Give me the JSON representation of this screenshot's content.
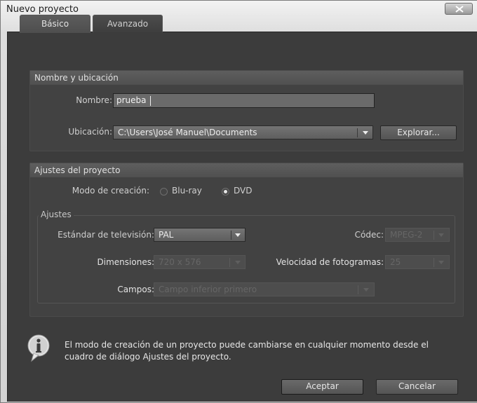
{
  "window": {
    "title": "Nuevo proyecto"
  },
  "tabs": [
    {
      "label": "Básico"
    },
    {
      "label": "Avanzado"
    }
  ],
  "name_location": {
    "header": "Nombre y ubicación",
    "name_label": "Nombre:",
    "name_value": "prueba",
    "location_label": "Ubicación:",
    "location_value": "C:\\Users\\José Manuel\\Documents",
    "browse_label": "Explorar..."
  },
  "project_settings": {
    "header": "Ajustes del proyecto",
    "creation_mode_label": "Modo de creación:",
    "modes": [
      {
        "label": "Blu-ray",
        "selected": false
      },
      {
        "label": "DVD",
        "selected": true
      }
    ],
    "settings_group": {
      "title": "Ajustes",
      "tv_standard_label": "Estándar de televisión:",
      "tv_standard_value": "PAL",
      "codec_label": "Códec:",
      "codec_value": "MPEG-2",
      "dimensions_label": "Dimensiones:",
      "dimensions_value": "720 x 576",
      "frame_rate_label": "Velocidad de fotogramas:",
      "frame_rate_value": "25",
      "fields_label": "Campos:",
      "fields_value": "Campo inferior primero"
    }
  },
  "info": {
    "icon": "info-icon",
    "line1": "El modo de creación de un proyecto puede cambiarse en cualquier momento desde el",
    "line2": "cuadro de diálogo Ajustes del proyecto."
  },
  "buttons": {
    "ok_label": "Aceptar",
    "cancel_label": "Cancelar"
  }
}
